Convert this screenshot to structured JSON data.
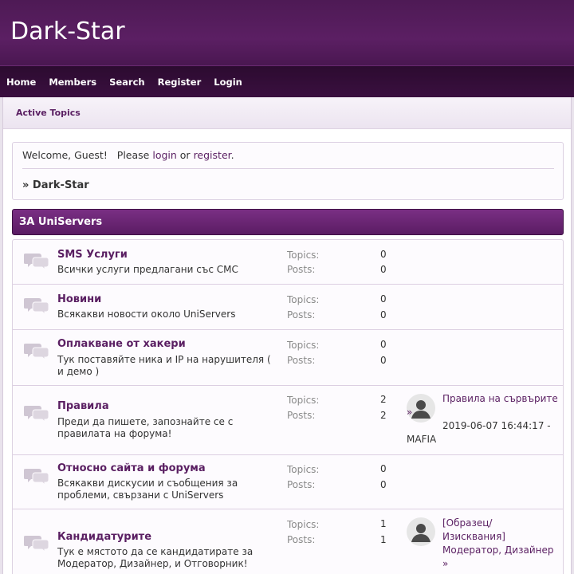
{
  "site": {
    "title": "Dark-Star"
  },
  "nav": {
    "items": [
      "Home",
      "Members",
      "Search",
      "Register",
      "Login"
    ]
  },
  "active_topics": "Active Topics",
  "welcome": {
    "greeting": "Welcome, Guest!",
    "please": "Please",
    "login": "login",
    "or": "or",
    "register": "register",
    "period": "."
  },
  "breadcrumb": "» Dark-Star",
  "category": {
    "title": "ЗА UniServers"
  },
  "labels": {
    "topics": "Topics:",
    "posts": "Posts:"
  },
  "boards": [
    {
      "name": "SMS Услуги",
      "desc": "Всички услуги предлагани със СМС",
      "topics": "0",
      "posts": "0"
    },
    {
      "name": "Новини",
      "desc": "Всякакви новости около UniServers",
      "topics": "0",
      "posts": "0"
    },
    {
      "name": "Оплакване от хакери",
      "desc": "Тук поставяйте ника и IP на нарушителя ( и демо )",
      "topics": "0",
      "posts": "0"
    },
    {
      "name": "Правила",
      "desc": "Преди да пишете, запознайте се с правилата на форума!",
      "topics": "2",
      "posts": "2",
      "last": {
        "title": "Правила на сървърите",
        "arrow": "»",
        "date": "2019-06-07 16:44:17",
        "sep": "-",
        "user": "MAFIA"
      }
    },
    {
      "name": "Относно сайта и форума",
      "desc": "Всякакви дискусии и съобщения за проблеми, свързани с UniServers",
      "topics": "0",
      "posts": "0"
    },
    {
      "name": "Кандидатурите",
      "desc": "Тук е мястото да се кандидатирате за Модератор, Дизайнер, и Отговорник!",
      "topics": "1",
      "posts": "1",
      "last": {
        "title": "[Образец/ Изисквания] Модератор, Дизайнер",
        "arrow": "»"
      }
    }
  ],
  "colors": {
    "header": "#5b1f63",
    "nav": "#33103a",
    "accent": "#5a1f62"
  }
}
